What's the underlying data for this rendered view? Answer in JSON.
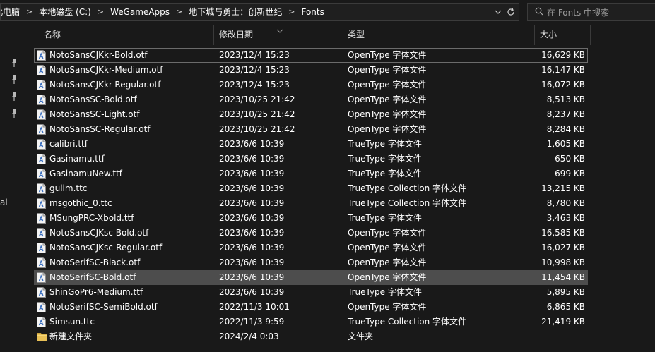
{
  "address_bar": {
    "crumbs": [
      "此电脑",
      "本地磁盘 (C:)",
      "WeGameApps",
      "地下城与勇士：创新世纪",
      "Fonts"
    ]
  },
  "search": {
    "placeholder": "在 Fonts 中搜索"
  },
  "side_pane": {
    "partial_label": "al"
  },
  "columns": {
    "name": "名称",
    "date": "修改日期",
    "type": "类型",
    "size": "大小"
  },
  "files": [
    {
      "name": "NotoSansCJKkr-Bold.otf",
      "date": "2023/12/4 15:23",
      "type": "OpenType 字体文件",
      "size": "16,629 KB",
      "icon": "font-file-icon"
    },
    {
      "name": "NotoSansCJKkr-Medium.otf",
      "date": "2023/12/4 15:23",
      "type": "OpenType 字体文件",
      "size": "16,147 KB",
      "icon": "font-file-icon"
    },
    {
      "name": "NotoSansCJKkr-Regular.otf",
      "date": "2023/12/4 15:23",
      "type": "OpenType 字体文件",
      "size": "16,072 KB",
      "icon": "font-file-icon"
    },
    {
      "name": "NotoSansSC-Bold.otf",
      "date": "2023/10/25 21:42",
      "type": "OpenType 字体文件",
      "size": "8,513 KB",
      "icon": "font-file-icon"
    },
    {
      "name": "NotoSansSC-Light.otf",
      "date": "2023/10/25 21:42",
      "type": "OpenType 字体文件",
      "size": "8,237 KB",
      "icon": "font-file-icon"
    },
    {
      "name": "NotoSansSC-Regular.otf",
      "date": "2023/10/25 21:42",
      "type": "OpenType 字体文件",
      "size": "8,284 KB",
      "icon": "font-file-icon"
    },
    {
      "name": "calibri.ttf",
      "date": "2023/6/6 10:39",
      "type": "TrueType 字体文件",
      "size": "1,605 KB",
      "icon": "font-file-icon"
    },
    {
      "name": "Gasinamu.ttf",
      "date": "2023/6/6 10:39",
      "type": "TrueType 字体文件",
      "size": "650 KB",
      "icon": "font-file-icon"
    },
    {
      "name": "GasinamuNew.ttf",
      "date": "2023/6/6 10:39",
      "type": "TrueType 字体文件",
      "size": "699 KB",
      "icon": "font-file-icon"
    },
    {
      "name": "gulim.ttc",
      "date": "2023/6/6 10:39",
      "type": "TrueType Collection 字体文件",
      "size": "13,215 KB",
      "icon": "font-file-icon"
    },
    {
      "name": "msgothic_0.ttc",
      "date": "2023/6/6 10:39",
      "type": "TrueType Collection 字体文件",
      "size": "8,780 KB",
      "icon": "font-file-icon"
    },
    {
      "name": "MSungPRC-Xbold.ttf",
      "date": "2023/6/6 10:39",
      "type": "TrueType 字体文件",
      "size": "3,463 KB",
      "icon": "font-file-icon"
    },
    {
      "name": "NotoSansCJKsc-Bold.otf",
      "date": "2023/6/6 10:39",
      "type": "OpenType 字体文件",
      "size": "16,585 KB",
      "icon": "font-file-icon"
    },
    {
      "name": "NotoSansCJKsc-Regular.otf",
      "date": "2023/6/6 10:39",
      "type": "OpenType 字体文件",
      "size": "16,027 KB",
      "icon": "font-file-icon"
    },
    {
      "name": "NotoSerifSC-Black.otf",
      "date": "2023/6/6 10:39",
      "type": "OpenType 字体文件",
      "size": "10,998 KB",
      "icon": "font-file-icon"
    },
    {
      "name": "NotoSerifSC-Bold.otf",
      "date": "2023/6/6 10:39",
      "type": "OpenType 字体文件",
      "size": "11,454 KB",
      "icon": "font-file-icon"
    },
    {
      "name": "ShinGoPr6-Medium.ttf",
      "date": "2023/6/6 10:39",
      "type": "TrueType 字体文件",
      "size": "5,895 KB",
      "icon": "font-file-icon"
    },
    {
      "name": "NotoSerifSC-SemiBold.otf",
      "date": "2022/11/3 10:01",
      "type": "OpenType 字体文件",
      "size": "6,865 KB",
      "icon": "font-file-icon"
    },
    {
      "name": "Simsun.ttc",
      "date": "2022/11/3 9:59",
      "type": "TrueType Collection 字体文件",
      "size": "21,419 KB",
      "icon": "font-file-icon"
    },
    {
      "name": "新建文件夹",
      "date": "2024/2/4 0:03",
      "type": "文件夹",
      "size": "",
      "icon": "folder-icon"
    }
  ],
  "focused_row": 0,
  "hovered_row": 15,
  "colors": {
    "background": "#191919",
    "hover": "#4d4d4d",
    "folder": "#e8c056"
  }
}
